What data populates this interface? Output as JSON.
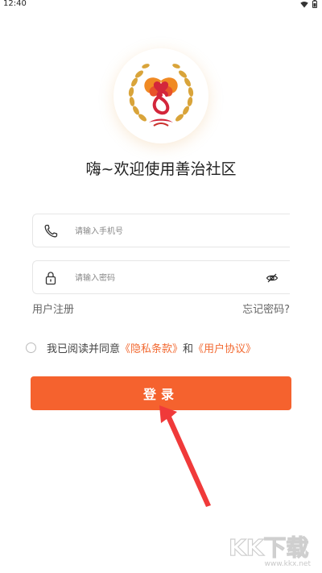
{
  "status": {
    "time": "12:40"
  },
  "welcome": "嗨~欢迎使用善治社区",
  "phone": {
    "placeholder": "请输入手机号"
  },
  "password": {
    "placeholder": "请输入密码"
  },
  "links": {
    "register": "用户注册",
    "forgot": "忘记密码?"
  },
  "agreement": {
    "prefix": "我已阅读并同意",
    "privacy": "《隐私条款》",
    "and": "和",
    "user": "《用户协议》"
  },
  "login": {
    "label": "登录"
  },
  "watermark": {
    "brand": "KK下载",
    "url": "www.kkx.net"
  },
  "colors": {
    "accent": "#f5622e",
    "link": "#f26a32"
  }
}
